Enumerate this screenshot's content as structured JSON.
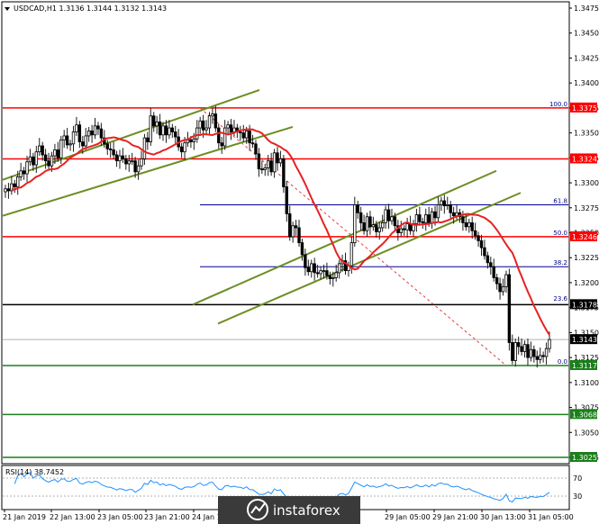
{
  "header": {
    "symbol_line": "USDCAD,H1  1.3136 1.3144 1.3132 1.3143"
  },
  "rsi_panel": {
    "label": "RSI(14) 38.7452",
    "levels": [
      "70",
      "30"
    ]
  },
  "watermark": {
    "text": "instaforex"
  },
  "colors": {
    "bull": "#2e7d32",
    "bear": "#c62828",
    "ma": "#e52222",
    "fib": "#00008b",
    "channel": "#6b8e23",
    "support": "#1b7f1b",
    "resistance": "#ff0000"
  },
  "chart_data": {
    "type": "candlestick",
    "y_axis": {
      "ticks": [
        "1.3475",
        "1.3450",
        "1.3425",
        "1.3400",
        "1.3375",
        "1.3350",
        "1.3325",
        "1.3300",
        "1.3275",
        "1.3250",
        "1.3225",
        "1.3200",
        "1.3175",
        "1.3150",
        "1.3125",
        "1.3100",
        "1.3075",
        "1.3050",
        "1.3025"
      ],
      "range": [
        1.3016,
        1.3484
      ]
    },
    "x_axis": {
      "ticks": [
        "21 Jan 2019",
        "22 Jan 13:00",
        "23 Jan 05:00",
        "23 Jan 21:00",
        "24 Jan 1",
        "29 Jan 05:00",
        "29 Jan 21:00",
        "30 Jan 13:00",
        "31 Jan 05:00"
      ]
    },
    "price_labels": [
      {
        "value": 1.3375,
        "text": "1.3375",
        "role": "resistance"
      },
      {
        "value": 1.3324,
        "text": "1.3324",
        "role": "resistance"
      },
      {
        "value": 1.3246,
        "text": "1.3246",
        "role": "resistance"
      },
      {
        "value": 1.3178,
        "text": "1.3178",
        "role": "pivot"
      },
      {
        "value": 1.3143,
        "text": "1.3143",
        "role": "current"
      },
      {
        "value": 1.3117,
        "text": "1.3117",
        "role": "support"
      },
      {
        "value": 1.3068,
        "text": "1.3068",
        "role": "support"
      },
      {
        "value": 1.3025,
        "text": "1.3025",
        "role": "support"
      }
    ],
    "fibonacci": [
      {
        "level": "100.0",
        "value": 1.3375
      },
      {
        "level": "61.8",
        "value": 1.3278
      },
      {
        "level": "50.0",
        "value": 1.3246
      },
      {
        "level": "38.2",
        "value": 1.3216
      },
      {
        "level": "23.6",
        "value": 1.318
      },
      {
        "level": "0.0",
        "value": 1.3117
      }
    ],
    "close": [
      1.3294,
      1.3292,
      1.3299,
      1.3296,
      1.3306,
      1.3312,
      1.3309,
      1.3321,
      1.3326,
      1.3318,
      1.3331,
      1.3337,
      1.3328,
      1.3322,
      1.3317,
      1.3327,
      1.3333,
      1.3325,
      1.3343,
      1.3347,
      1.3338,
      1.3339,
      1.3351,
      1.3358,
      1.3341,
      1.3337,
      1.3347,
      1.3352,
      1.3348,
      1.3357,
      1.3354,
      1.3345,
      1.3339,
      1.3334,
      1.3333,
      1.3328,
      1.3322,
      1.3327,
      1.3324,
      1.3319,
      1.3322,
      1.3322,
      1.3311,
      1.3317,
      1.3324,
      1.3345,
      1.3341,
      1.3367,
      1.3357,
      1.3361,
      1.3348,
      1.3357,
      1.3348,
      1.3355,
      1.3351,
      1.3346,
      1.3336,
      1.3331,
      1.334,
      1.3343,
      1.3341,
      1.3344,
      1.3355,
      1.3362,
      1.3353,
      1.3355,
      1.3367,
      1.3369,
      1.3355,
      1.334,
      1.3337,
      1.3355,
      1.3358,
      1.3351,
      1.3355,
      1.3351,
      1.335,
      1.3345,
      1.3352,
      1.334,
      1.3339,
      1.3329,
      1.3314,
      1.3313,
      1.3315,
      1.3322,
      1.3311,
      1.333,
      1.332,
      1.3324,
      1.3296,
      1.3269,
      1.3246,
      1.3257,
      1.3255,
      1.324,
      1.3228,
      1.3215,
      1.3211,
      1.3219,
      1.321,
      1.3209,
      1.3212,
      1.3212,
      1.3207,
      1.3204,
      1.3205,
      1.321,
      1.3219,
      1.3222,
      1.3212,
      1.3217,
      1.324,
      1.3278,
      1.327,
      1.326,
      1.3252,
      1.3266,
      1.3256,
      1.3258,
      1.3251,
      1.3255,
      1.326,
      1.3273,
      1.3262,
      1.3266,
      1.3257,
      1.325,
      1.3254,
      1.3253,
      1.3259,
      1.3252,
      1.3259,
      1.3268,
      1.3261,
      1.326,
      1.3268,
      1.326,
      1.3271,
      1.3265,
      1.3278,
      1.3282,
      1.3277,
      1.3278,
      1.327,
      1.3267,
      1.327,
      1.3266,
      1.326,
      1.3256,
      1.326,
      1.3252,
      1.3247,
      1.3242,
      1.3235,
      1.3227,
      1.322,
      1.3216,
      1.3205,
      1.3199,
      1.3191,
      1.3196,
      1.3208,
      1.314,
      1.3122,
      1.314,
      1.3136,
      1.3131,
      1.3138,
      1.3125,
      1.3133,
      1.3126,
      1.3123,
      1.3127,
      1.3126,
      1.3134,
      1.3143
    ]
  }
}
